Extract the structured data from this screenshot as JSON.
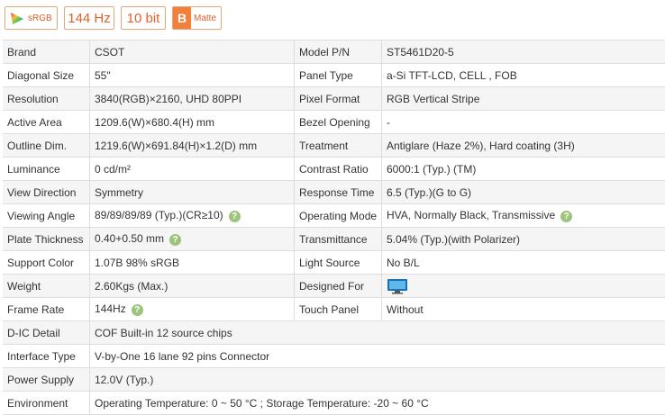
{
  "badges": {
    "srgb": "sRGB",
    "refresh": "144 Hz",
    "bit": "10 bit",
    "matte_letter": "B",
    "matte": "Matte"
  },
  "specs": [
    {
      "k1": "Brand",
      "v1": "CSOT",
      "k2": "Model P/N",
      "v2": "ST5461D20-5"
    },
    {
      "k1": "Diagonal Size",
      "v1": "55\"",
      "k2": "Panel Type",
      "v2": "a-Si TFT-LCD, CELL , FOB"
    },
    {
      "k1": "Resolution",
      "v1": "3840(RGB)×2160, UHD  80PPI",
      "k2": "Pixel Format",
      "v2": "RGB Vertical Stripe"
    },
    {
      "k1": "Active Area",
      "v1": "1209.6(W)×680.4(H) mm",
      "k2": "Bezel Opening",
      "v2": "-"
    },
    {
      "k1": "Outline Dim.",
      "v1": "1219.6(W)×691.84(H)×1.2(D) mm",
      "k2": "Treatment",
      "v2": "Antiglare (Haze 2%), Hard coating (3H)"
    },
    {
      "k1": "Luminance",
      "v1": "0 cd/m²",
      "k2": "Contrast Ratio",
      "v2": "6000:1 (Typ.) (TM)"
    },
    {
      "k1": "View Direction",
      "v1": "Symmetry",
      "k2": "Response Time",
      "v2": "6.5 (Typ.)(G to G)"
    },
    {
      "k1": "Viewing Angle",
      "v1": "89/89/89/89 (Typ.)(CR≥10)",
      "k2": "Operating Mode",
      "v2": "HVA, Normally Black, Transmissive"
    },
    {
      "k1": "Plate Thickness",
      "v1": "0.40+0.50 mm",
      "k2": "Transmittance",
      "v2": "5.04% (Typ.)(with Polarizer)"
    },
    {
      "k1": "Support Color",
      "v1": "1.07B   98% sRGB",
      "k2": "Light Source",
      "v2": "No B/L"
    },
    {
      "k1": "Weight",
      "v1": "2.60Kgs (Max.)",
      "k2": "Designed For",
      "v2": ""
    },
    {
      "k1": "Frame Rate",
      "v1": "144Hz",
      "k2": "Touch Panel",
      "v2": "Without"
    }
  ],
  "wide": [
    {
      "k": "D-IC Detail",
      "v": "COF Built-in 12 source chips"
    },
    {
      "k": "Interface Type",
      "v": "V-by-One 16 lane 92 pins Connector"
    },
    {
      "k": "Power Supply",
      "v": "12.0V (Typ.)"
    },
    {
      "k": "Environment",
      "v": "Operating Temperature: 0 ~ 50 °C ; Storage Temperature: -20 ~ 60 °C"
    }
  ],
  "help_glyph": "?",
  "icons": {
    "help": "question-circle-icon",
    "designed_for": "monitor-icon"
  }
}
